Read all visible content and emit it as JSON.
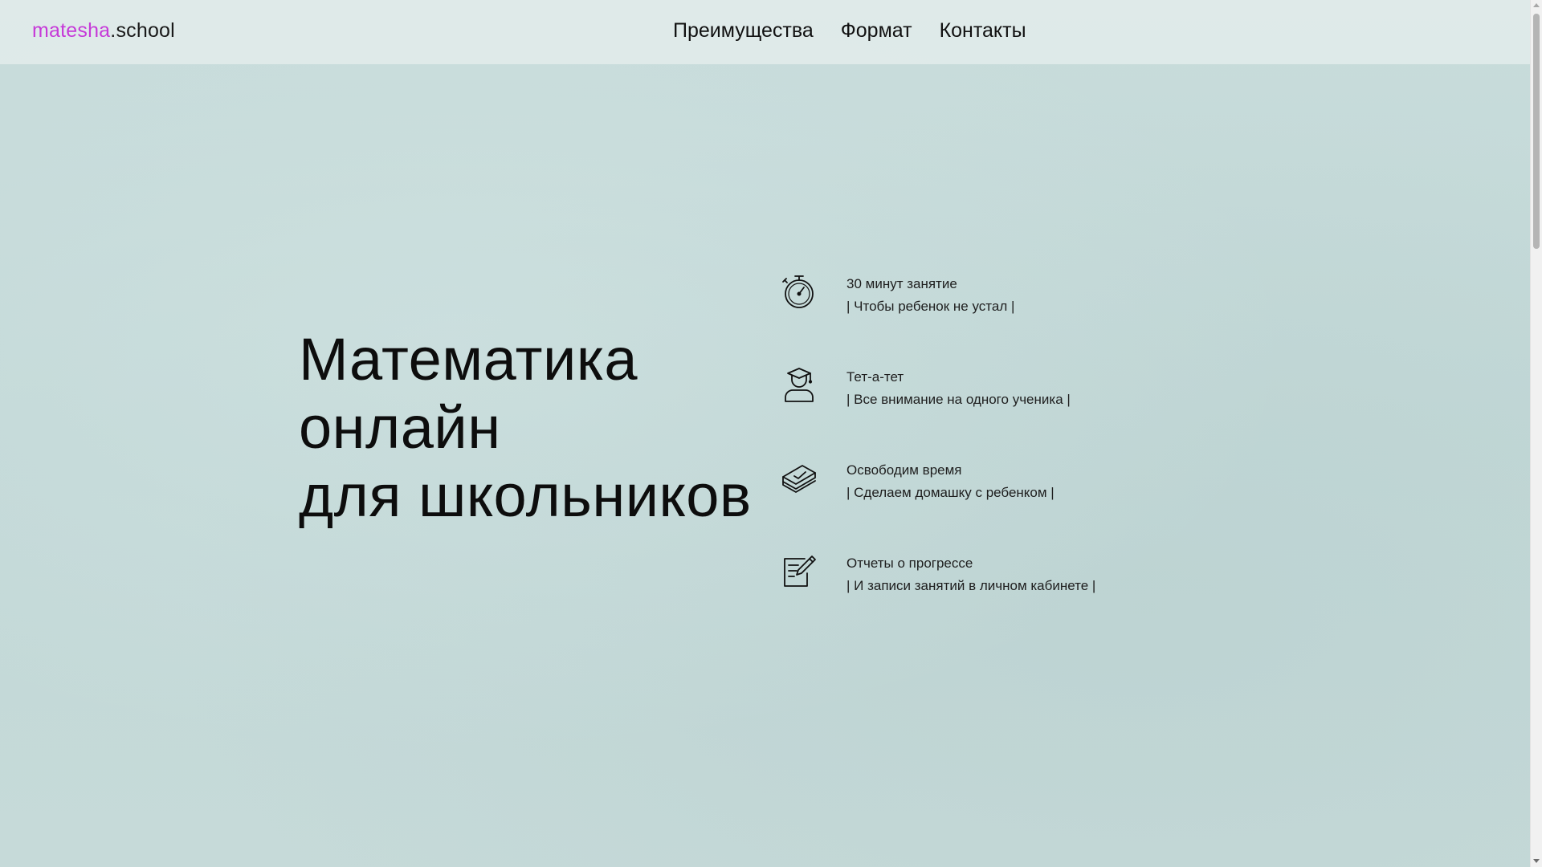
{
  "header": {
    "logo_accent": "matesha",
    "logo_rest": ".school",
    "nav": [
      {
        "label": "Преимущества"
      },
      {
        "label": "Формат"
      },
      {
        "label": "Контакты"
      }
    ]
  },
  "hero": {
    "title_lines": [
      "Математика",
      "онлайн",
      "для школьников"
    ]
  },
  "features": [
    {
      "icon": "stopwatch-icon",
      "title": "30 минут занятие",
      "subtitle": "| Чтобы ребенок не устал |"
    },
    {
      "icon": "student-graduate-icon",
      "title": "Тет-а-тет",
      "subtitle": "| Все внимание на одного ученика |"
    },
    {
      "icon": "book-check-icon",
      "title": "Освободим время",
      "subtitle": "| Сделаем домашку с ребенком |"
    },
    {
      "icon": "notepad-pencil-icon",
      "title": "Отчеты о прогрессе",
      "subtitle": "| И записи занятий в личном кабинете |"
    }
  ],
  "colors": {
    "accent": "#c63ad8",
    "background": "#c4d9d8",
    "text": "#111111"
  }
}
